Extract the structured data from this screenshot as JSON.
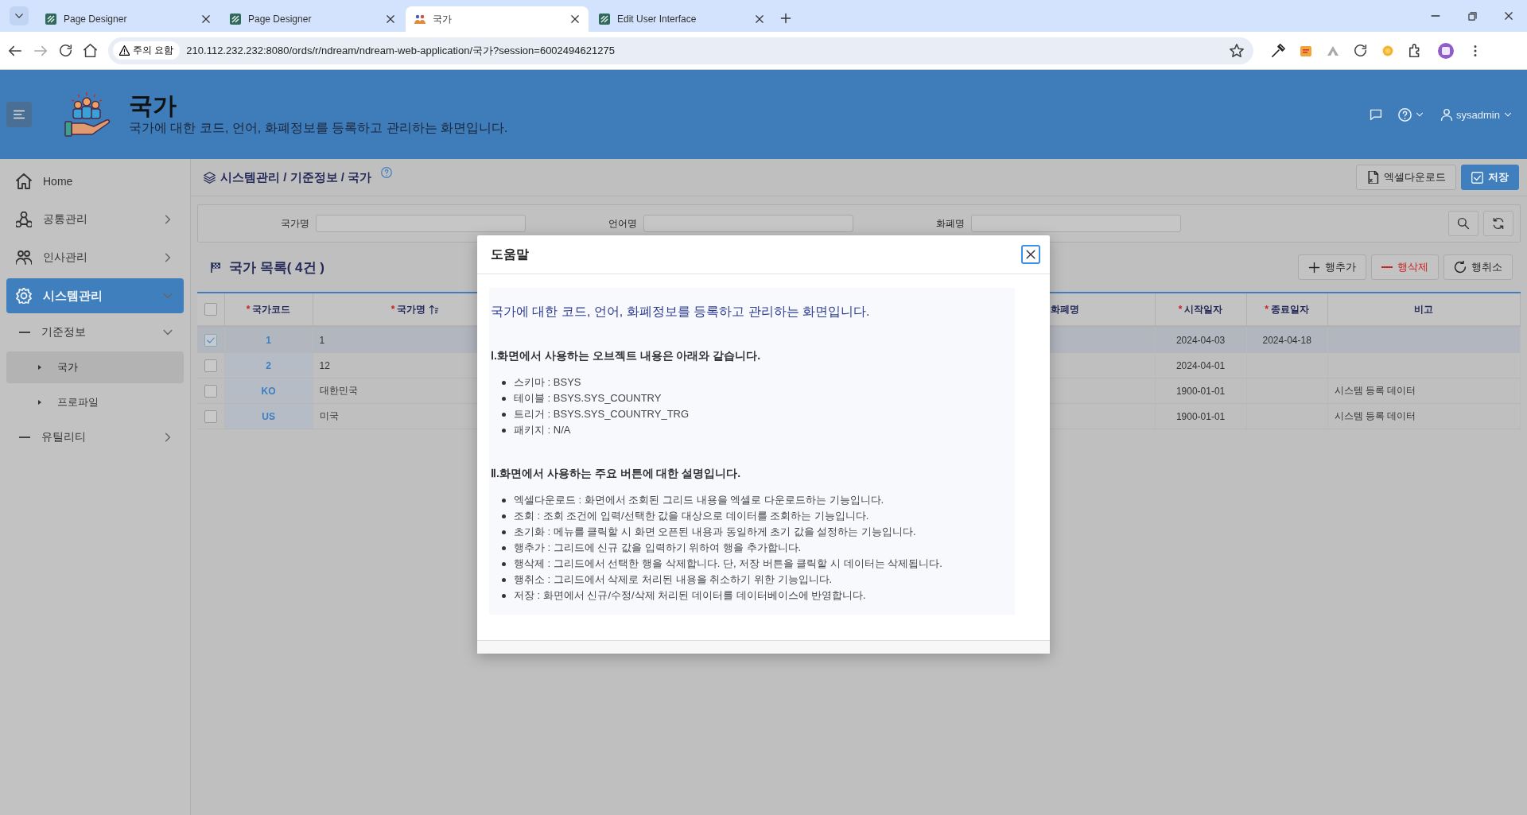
{
  "browser": {
    "tabs": [
      {
        "title": "Page Designer",
        "selected": false
      },
      {
        "title": "Page Designer",
        "selected": false
      },
      {
        "title": "국가",
        "selected": true
      },
      {
        "title": "Edit User Interface",
        "selected": false
      }
    ],
    "security_chip": "주의 요함",
    "url": "210.112.232.232:8080/ords/r/ndream/ndream-web-application/국가?session=6002494621275"
  },
  "header": {
    "title": "국가",
    "subtitle": "국가에 대한 코드, 언어, 화폐정보를 등록하고 관리하는 화면입니다.",
    "user": "sysadmin"
  },
  "sidebar": {
    "items": [
      {
        "label": "Home",
        "kind": "home",
        "selected": false
      },
      {
        "label": "공통관리",
        "kind": "nodes",
        "selected": false,
        "expanded": false
      },
      {
        "label": "인사관리",
        "kind": "people",
        "selected": false,
        "expanded": false
      },
      {
        "label": "시스템관리",
        "kind": "gear",
        "selected": true,
        "expanded": true,
        "children": [
          {
            "label": "기준정보",
            "selected": false,
            "expanded": true,
            "children": [
              {
                "label": "국가",
                "selected": true
              },
              {
                "label": "프로파일",
                "selected": false
              }
            ]
          },
          {
            "label": "유틸리티",
            "selected": false,
            "expanded": false
          }
        ]
      }
    ]
  },
  "breadcrumb": "시스템관리 / 기준정보 / 국가",
  "toolbar": [
    {
      "label": "엑셀다운로드",
      "kind": "excel"
    },
    {
      "label": "저장",
      "kind": "save"
    }
  ],
  "filters": [
    {
      "label": "국가명"
    },
    {
      "label": "언어명"
    },
    {
      "label": "화폐명"
    }
  ],
  "list": {
    "title": "국가 목록( 4건 )",
    "actions": [
      {
        "label": "행추가",
        "kind": "add"
      },
      {
        "label": "행삭제",
        "kind": "delete"
      },
      {
        "label": "행취소",
        "kind": "undo"
      }
    ]
  },
  "table": {
    "all_selected": false,
    "columns": [
      {
        "required_mark": "*",
        "label": "국가코드",
        "sorted": false
      },
      {
        "required_mark": "*",
        "label": "국가명",
        "sorted": true
      },
      {
        "label": "화폐명",
        "sorted": false
      },
      {
        "required_mark": "*",
        "label": "시작일자",
        "sorted": false
      },
      {
        "required_mark": "*",
        "label": "종료일자",
        "sorted": false
      },
      {
        "label": "비고",
        "sorted": false
      }
    ],
    "rows": [
      {
        "selected": true,
        "code": "1",
        "name": "1",
        "start_date": "2024-04-03",
        "end_date": "2024-04-18"
      },
      {
        "selected": false,
        "code": "2",
        "name": "12",
        "start_date": "2024-04-01"
      },
      {
        "selected": false,
        "code": "KO",
        "name": "대한민국",
        "start_date": "1900-01-01",
        "note": "시스템 등록 데이터"
      },
      {
        "selected": false,
        "code": "US",
        "name": "미국",
        "start_date": "1900-01-01",
        "note": "시스템 등록 데이터"
      }
    ]
  },
  "modal": {
    "title": "도움말",
    "lead": "국가에 대한 코드, 언어, 화폐정보를 등록하고 관리하는 화면입니다.",
    "sections": [
      {
        "heading": "Ⅰ.화면에서 사용하는 오브젝트 내용은 아래와 같습니다.",
        "items": [
          "스키마 : BSYS",
          "테이블 : BSYS.SYS_COUNTRY",
          "트리거 : BSYS.SYS_COUNTRY_TRG",
          "패키지 : N/A"
        ]
      },
      {
        "heading": "Ⅱ.화면에서 사용하는 주요 버튼에 대한 설명입니다.",
        "items": [
          "엑셀다운로드 : 화면에서 조회된 그리드 내용을 엑셀로 다운로드하는 기능입니다.",
          "조회 : 조회 조건에 입력/선택한 값을 대상으로 데이터를 조회하는 기능입니다.",
          "초기화 : 메뉴를 클릭할 시 화면 오픈된 내용과 동일하게 초기 값을 설정하는 기능입니다.",
          "행추가 : 그리드에 신규 값을 입력하기 위하여 행을 추가합니다.",
          "행삭제 : 그리드에서 선택한 행을 삭제합니다. 단, 저장 버튼을 클릭할 시 데이터는 삭제됩니다.",
          "행취소 : 그리드에서 삭제로 처리된 내용을 취소하기 위한 기능입니다.",
          "저장 : 화면에서 신규/수정/삭제 처리된 데이터를 데이터베이스에 반영합니다."
        ]
      }
    ]
  }
}
